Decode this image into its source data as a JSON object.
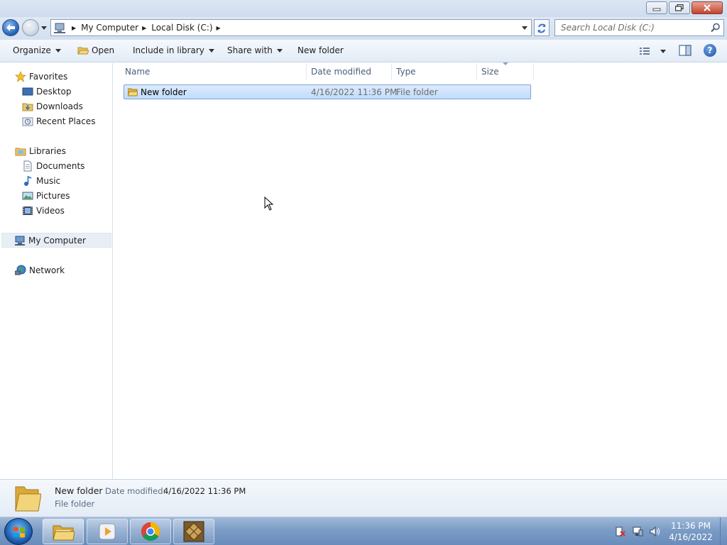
{
  "window": {
    "controls": [
      "minimize",
      "restore",
      "close"
    ]
  },
  "address": {
    "crumbs": [
      "My Computer",
      "Local Disk (C:)"
    ],
    "search_placeholder": "Search Local Disk (C:)"
  },
  "toolbar": {
    "organize": "Organize",
    "open": "Open",
    "include_in_library": "Include in library",
    "share_with": "Share with",
    "new_folder": "New folder"
  },
  "nav": {
    "favorites": "Favorites",
    "desktop": "Desktop",
    "downloads": "Downloads",
    "recent_places": "Recent Places",
    "libraries": "Libraries",
    "documents": "Documents",
    "music": "Music",
    "pictures": "Pictures",
    "videos": "Videos",
    "my_computer": "My Computer",
    "network": "Network"
  },
  "columns": {
    "name": "Name",
    "date_modified": "Date modified",
    "type": "Type",
    "size": "Size"
  },
  "files": [
    {
      "name": "New folder",
      "date_modified": "4/16/2022 11:36 PM",
      "type": "File folder",
      "size": "",
      "selected": true
    }
  ],
  "details": {
    "name": "New folder",
    "date_label": "Date modified:",
    "date_value": "4/16/2022 11:36 PM",
    "type": "File folder"
  },
  "taskbar": {
    "apps": [
      "windows-explorer",
      "media-player",
      "chrome",
      "dosbox"
    ],
    "clock_time": "11:36 PM",
    "clock_date": "4/16/2022"
  },
  "colors": {
    "selection": "#c1dcfc",
    "selection_border": "#7da2ce",
    "header_text": "#4c607a"
  }
}
